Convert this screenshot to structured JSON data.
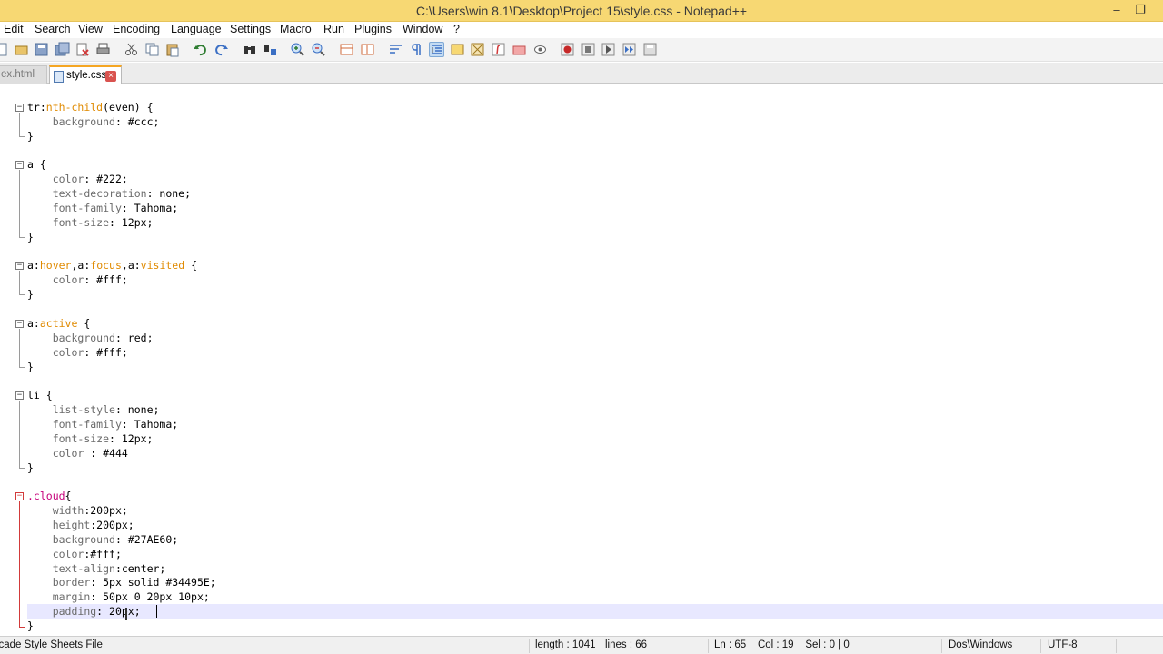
{
  "window": {
    "title": "C:\\Users\\win 8.1\\Desktop\\Project 15\\style.css - Notepad++",
    "minimize_glyph": "–",
    "restore_glyph": "❐"
  },
  "menu": [
    "Edit",
    "Search",
    "View",
    "Encoding",
    "Language",
    "Settings",
    "Macro",
    "Run",
    "Plugins",
    "Window",
    "?"
  ],
  "toolbar_icons": [
    "new-file-icon",
    "open-file-icon",
    "save-icon",
    "save-all-icon",
    "close-icon",
    "close-all-icon",
    "print-icon",
    "cut-icon",
    "copy-icon",
    "paste-icon",
    "undo-icon",
    "redo-icon",
    "find-icon",
    "replace-icon",
    "zoom-in-icon",
    "zoom-out-icon",
    "sync-vertical-icon",
    "sync-horizontal-icon",
    "word-wrap-icon",
    "show-all-chars-icon",
    "indent-guide-icon",
    "user-language-icon",
    "doc-map-icon",
    "function-list-icon",
    "folder-workspace-icon",
    "monitor-icon",
    "record-macro-icon",
    "stop-record-icon",
    "play-macro-icon",
    "run-macro-multiple-icon",
    "save-macro-icon"
  ],
  "tabs": {
    "inactive_label": "ex.html",
    "active_label": "style.css",
    "close_glyph": "×"
  },
  "fold": {
    "open": "−"
  },
  "code": {
    "l1": {
      "a": "tr",
      "b": ":",
      "c": "nth-child",
      "d": "(even) {"
    },
    "l2": {
      "p": "background",
      "v": ": #ccc;"
    },
    "l3": "}",
    "l5": "a {",
    "l6": {
      "p": "color",
      "v": ": #222;"
    },
    "l7": {
      "p": "text-decoration",
      "v": ": none;"
    },
    "l8": {
      "p": "font-family",
      "v": ": Tahoma;"
    },
    "l9": {
      "p": "font-size",
      "v": ": 12px;"
    },
    "l10": "}",
    "l12": {
      "a": "a:",
      "b": "hover",
      "c": ",a:",
      "d": "focus",
      "e": ",a:",
      "f": "visited",
      "g": " {"
    },
    "l13": {
      "p": "color",
      "v": ": #fff;"
    },
    "l14": "}",
    "l16": {
      "a": "a:",
      "b": "active",
      "c": " {"
    },
    "l17": {
      "p": "background",
      "v": ": red;"
    },
    "l18": {
      "p": "color",
      "v": ": #fff;"
    },
    "l19": "}",
    "l21": "li {",
    "l22": {
      "p": "list-style",
      "v": ": none;"
    },
    "l23": {
      "p": "font-family",
      "v": ": Tahoma;"
    },
    "l24": {
      "p": "font-size",
      "v": ": 12px;"
    },
    "l25": {
      "p": "color",
      "v": " : #444"
    },
    "l26": "}",
    "l28": {
      "a": ".cloud",
      "b": "{"
    },
    "l29": {
      "p": "width",
      "v": ":200px;"
    },
    "l30": {
      "p": "height",
      "v": ":200px;"
    },
    "l31": {
      "p": "background",
      "v": ": #27AE60;"
    },
    "l32": {
      "p": "color",
      "v": ":#fff;"
    },
    "l33": {
      "p": "text-align",
      "v": ":center;"
    },
    "l34": {
      "p": "border",
      "v": ": 5px solid #34495E;"
    },
    "l35": {
      "p": "margin",
      "v": ": 50px 0 20px 10px;"
    },
    "l36": {
      "p": "padding",
      "v": ": 20px;"
    },
    "l37": "}"
  },
  "status": {
    "file_type": "Cascade Style Sheets File",
    "length": "length : 1041",
    "lines": "lines : 66",
    "position": "Ln : 65    Col : 19    Sel : 0 | 0",
    "eol": "Dos\\Windows",
    "encoding": "UTF-8"
  }
}
